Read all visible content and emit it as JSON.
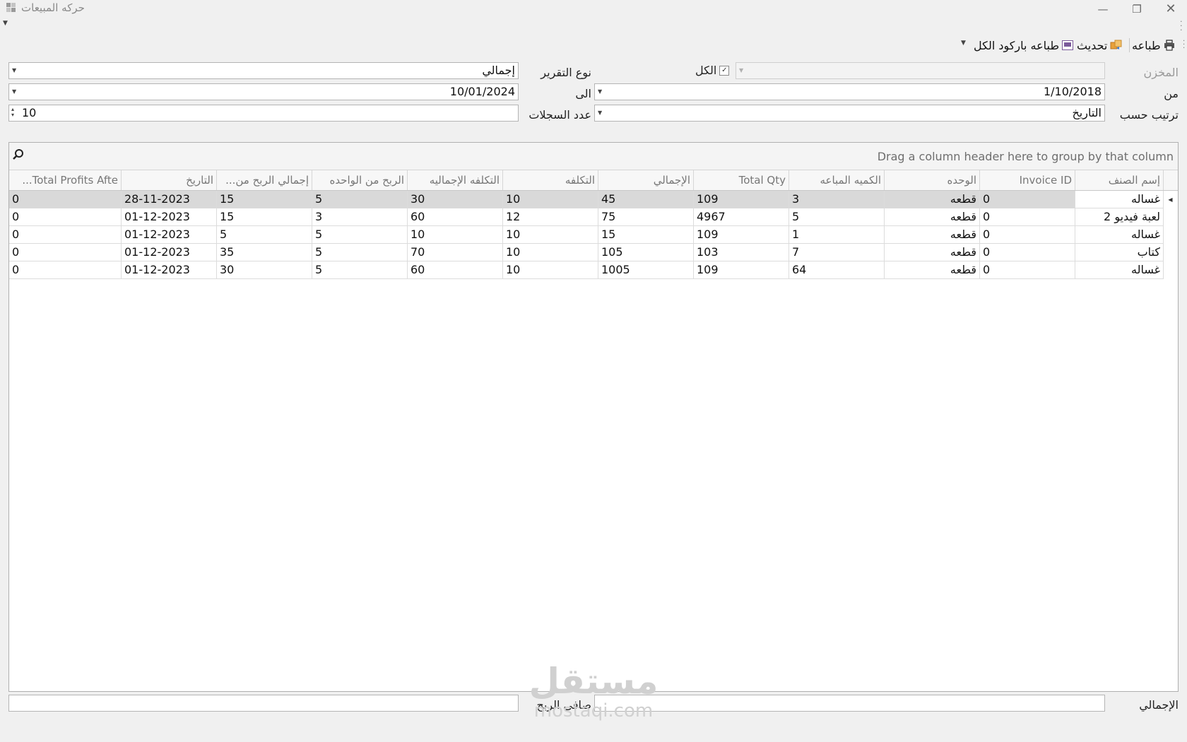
{
  "window": {
    "title": "حركه المبيعات"
  },
  "toolbar": {
    "print_label": "طباعه",
    "refresh_label": "تحديث",
    "barcode_label": "طباعه باركود الكل"
  },
  "filters": {
    "warehouse_label": "المخزن",
    "all_label": "الكل",
    "all_checked": true,
    "report_type_label": "نوع التقرير",
    "report_type_value": "إجمالي",
    "from_label": "من",
    "from_value": "1/10/2018",
    "to_label": "الى",
    "to_value": "10/01/2024",
    "sort_label": "ترتيب حسب",
    "sort_value": "التاريخ",
    "records_label": "عدد السجلات",
    "records_value": "10"
  },
  "grid": {
    "group_hint": "Drag a column header here to group by that column",
    "columns": [
      "إسم الصنف",
      "Invoice ID",
      "الوحده",
      "الكميه المباعه",
      "Total Qty",
      "الإجمالي",
      "التكلفه",
      "التكلفه الإجماليه",
      "الربح من الواحده",
      "إجمالي الربح من...",
      "التاريخ",
      "Total Profits Afte..."
    ],
    "rows": [
      [
        "غساله",
        "0",
        "قطعه",
        "3",
        "109",
        "45",
        "10",
        "30",
        "5",
        "15",
        "28-11-2023",
        "0"
      ],
      [
        "لعبة فيديو 2",
        "0",
        "قطعه",
        "5",
        "4967",
        "75",
        "12",
        "60",
        "3",
        "15",
        "01-12-2023",
        "0"
      ],
      [
        "غساله",
        "0",
        "قطعه",
        "1",
        "109",
        "15",
        "10",
        "10",
        "5",
        "5",
        "01-12-2023",
        "0"
      ],
      [
        "كتاب",
        "0",
        "قطعه",
        "7",
        "103",
        "105",
        "10",
        "70",
        "5",
        "35",
        "01-12-2023",
        "0"
      ],
      [
        "غساله",
        "0",
        "قطعه",
        "64",
        "109",
        "1005",
        "10",
        "60",
        "5",
        "30",
        "01-12-2023",
        "0"
      ]
    ],
    "selected_row": 0
  },
  "footer": {
    "total_label": "الإجمالي",
    "net_profit_label": "صافي الربح",
    "total_value": "",
    "net_profit_value": ""
  },
  "watermark": {
    "arabic": "مستقل",
    "latin": "mostaqi.com"
  }
}
